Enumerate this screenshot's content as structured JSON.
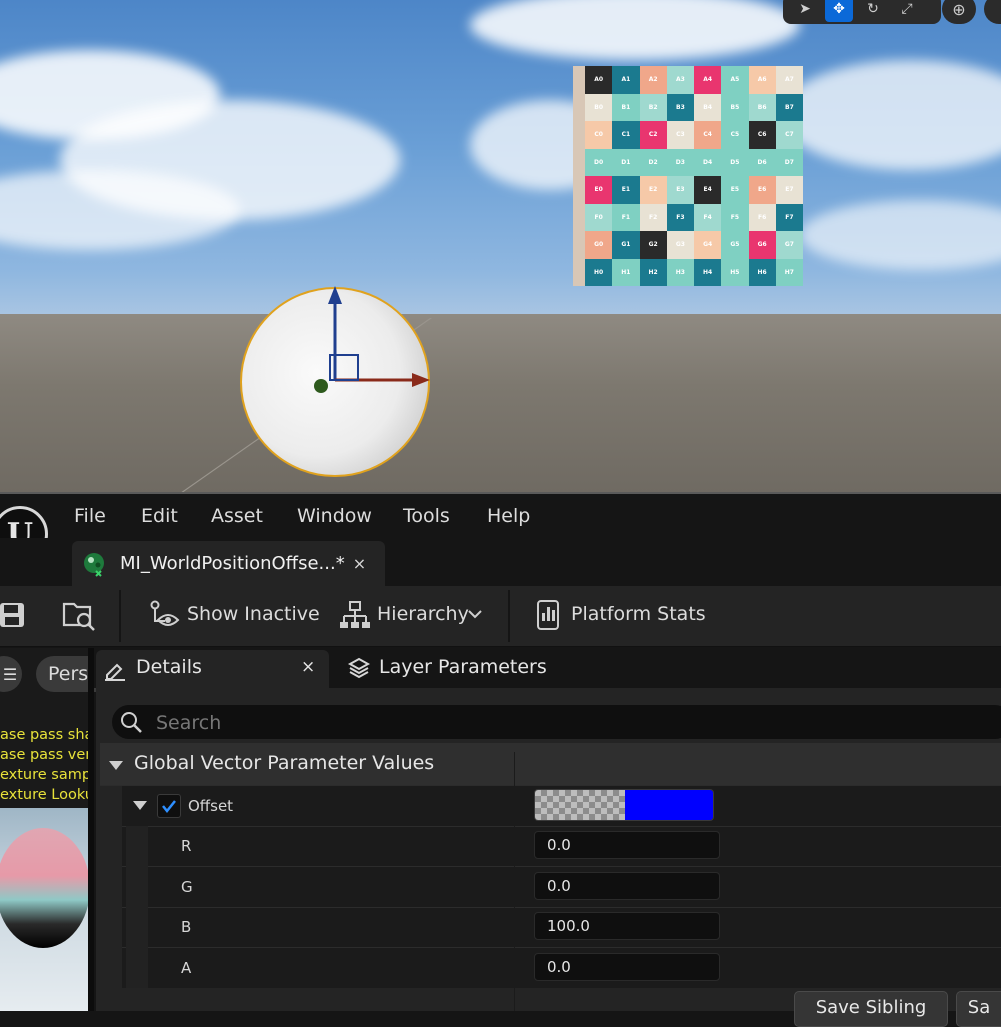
{
  "menu": {
    "items": [
      "File",
      "Edit",
      "Asset",
      "Window",
      "Tools",
      "Help"
    ]
  },
  "document_tab": {
    "label": "MI_WorldPositionOffse...*",
    "close": "×"
  },
  "toolbar": {
    "show_inactive": "Show Inactive",
    "hierarchy": "Hierarchy",
    "platform_stats": "Platform Stats"
  },
  "preview": {
    "view_mode": "Pers",
    "stats": [
      "ase pass sha",
      "ase pass ver",
      "exture samp",
      "exture Looku"
    ]
  },
  "details": {
    "tab_label": "Details",
    "tab_close": "×",
    "layer_tab_label": "Layer Parameters",
    "search_placeholder": "Search",
    "category": "Global Vector Parameter Values",
    "param": {
      "name": "Offset",
      "enabled": true,
      "color": "#0000ff",
      "channels": [
        {
          "label": "R",
          "value": "0.0"
        },
        {
          "label": "G",
          "value": "0.0"
        },
        {
          "label": "B",
          "value": "100.0"
        },
        {
          "label": "A",
          "value": "0.0"
        }
      ]
    },
    "buttons": {
      "save_sibling": "Save Sibling",
      "save_child": "Sa"
    }
  },
  "viewport": {
    "cube_labels": [
      [
        "A0",
        "A1",
        "A2",
        "A3",
        "A4",
        "A5",
        "A6",
        "A7"
      ],
      [
        "B0",
        "B1",
        "B2",
        "B3",
        "B4",
        "B5",
        "B6",
        "B7"
      ],
      [
        "C0",
        "C1",
        "C2",
        "C3",
        "C4",
        "C5",
        "C6",
        "C7"
      ],
      [
        "D0",
        "D1",
        "D2",
        "D3",
        "D4",
        "D5",
        "D6",
        "D7"
      ],
      [
        "E0",
        "E1",
        "E2",
        "E3",
        "E4",
        "E5",
        "E6",
        "E7"
      ],
      [
        "F0",
        "F1",
        "F2",
        "F3",
        "F4",
        "F5",
        "F6",
        "F7"
      ],
      [
        "G0",
        "G1",
        "G2",
        "G3",
        "G4",
        "G5",
        "G6",
        "G7"
      ],
      [
        "H0",
        "H1",
        "H2",
        "H3",
        "H4",
        "H5",
        "H6",
        "H7"
      ]
    ],
    "cube_colors": [
      "#2a2a2a",
      "#7fd0c2",
      "#f0a78a",
      "#e8e2d4",
      "#e9356f",
      "#1b7a8f",
      "#f6c9a8",
      "#9fd9cf"
    ],
    "accent": "#0b69d8"
  }
}
